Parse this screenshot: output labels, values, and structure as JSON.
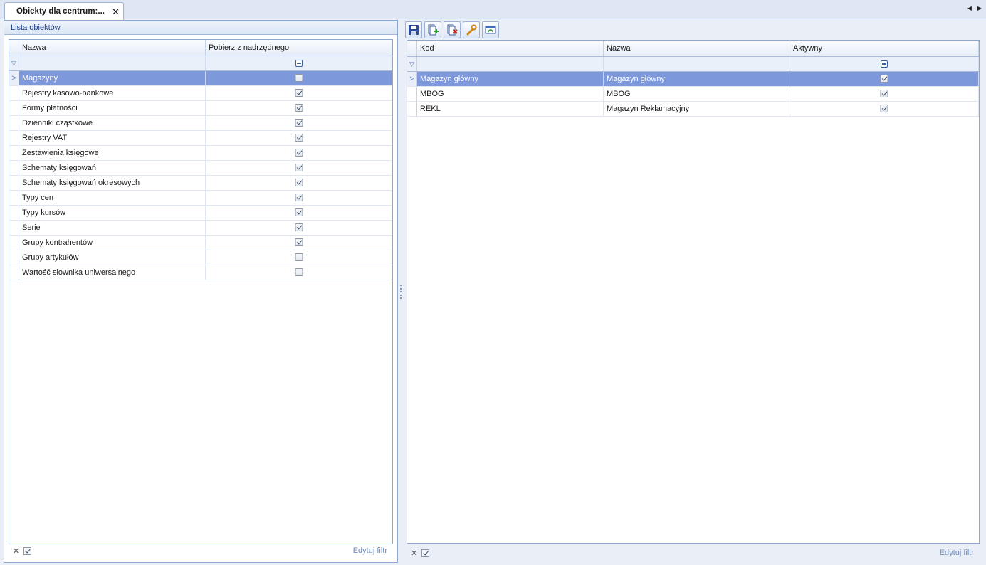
{
  "tab": {
    "title": "Obiekty dla centrum:...",
    "close_glyph": "✕"
  },
  "nav": {
    "prev_glyph": "◀",
    "next_glyph": "▶"
  },
  "left_panel": {
    "caption": "Lista obiektów",
    "columns": [
      "Nazwa",
      "Pobierz z nadrzędnego"
    ],
    "rows": [
      {
        "name": "Magazyny",
        "inherit": false,
        "selected": true
      },
      {
        "name": "Rejestry kasowo-bankowe",
        "inherit": true
      },
      {
        "name": "Formy płatności",
        "inherit": true
      },
      {
        "name": "Dzienniki cząstkowe",
        "inherit": true
      },
      {
        "name": "Rejestry VAT",
        "inherit": true
      },
      {
        "name": "Zestawienia księgowe",
        "inherit": true
      },
      {
        "name": "Schematy księgowań",
        "inherit": true
      },
      {
        "name": "Schematy księgowań okresowych",
        "inherit": true
      },
      {
        "name": "Typy cen",
        "inherit": true
      },
      {
        "name": "Typy kursów",
        "inherit": true
      },
      {
        "name": "Serie",
        "inherit": true
      },
      {
        "name": "Grupy kontrahentów",
        "inherit": true
      },
      {
        "name": "Grupy artykułów",
        "inherit": false
      },
      {
        "name": "Wartość słownika uniwersalnego",
        "inherit": false
      }
    ],
    "footer": {
      "clear_glyph": "✕",
      "filter_enabled": true,
      "edit_filter": "Edytuj filtr"
    }
  },
  "right_panel": {
    "toolbar": [
      {
        "name": "save-button",
        "icon": "floppy-disk-icon"
      },
      {
        "name": "add-button",
        "icon": "add-document-icon"
      },
      {
        "name": "delete-button",
        "icon": "delete-document-icon"
      },
      {
        "name": "edit-button",
        "icon": "wrench-icon"
      },
      {
        "name": "refresh-button",
        "icon": "refresh-window-icon"
      }
    ],
    "columns": [
      "Kod",
      "Nazwa",
      "Aktywny"
    ],
    "rows": [
      {
        "kod": "Magazyn główny",
        "nazwa": "Magazyn główny",
        "aktywny": true,
        "selected": true
      },
      {
        "kod": "MBOG",
        "nazwa": "MBOG",
        "aktywny": true
      },
      {
        "kod": "REKL",
        "nazwa": "Magazyn Reklamacyjny",
        "aktywny": true
      }
    ],
    "footer": {
      "clear_glyph": "✕",
      "filter_enabled": true,
      "edit_filter": "Edytuj filtr"
    }
  },
  "colors": {
    "selection": "#7e98dc",
    "panel_border": "#8fa8d2",
    "caption_text": "#1f3f86",
    "link": "#6f8bbd"
  }
}
